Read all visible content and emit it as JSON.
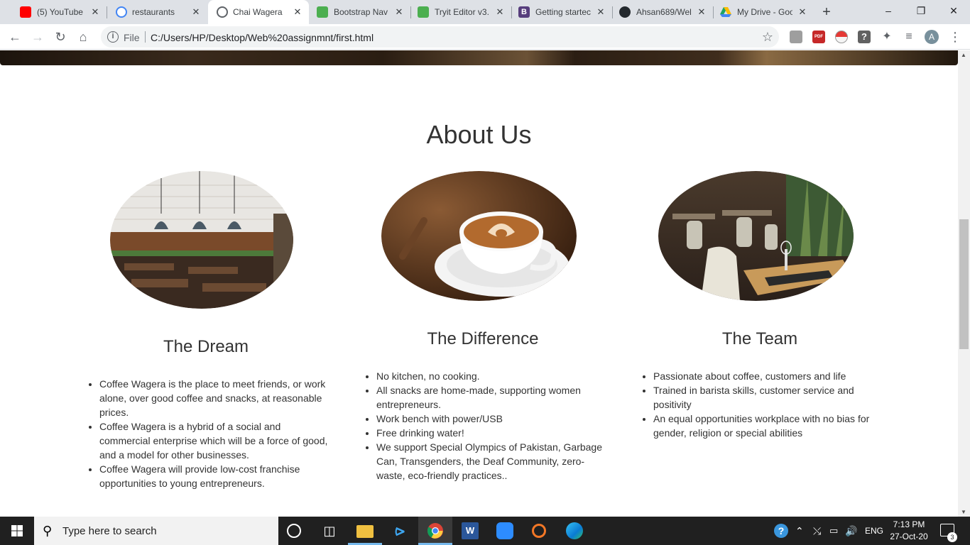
{
  "browser": {
    "tabs": [
      {
        "title": "(5) YouTube",
        "icon": "youtube-icon",
        "color": "#ff0000"
      },
      {
        "title": "restaurants ba",
        "icon": "google-icon",
        "color": "#4285f4"
      },
      {
        "title": "Chai Wagera",
        "icon": "globe-icon",
        "color": "#5f6368",
        "active": true
      },
      {
        "title": "Bootstrap Nav",
        "icon": "w3schools-icon",
        "color": "#4caf50"
      },
      {
        "title": "Tryit Editor v3.",
        "icon": "w3schools-icon",
        "color": "#4caf50"
      },
      {
        "title": "Getting startec",
        "icon": "bootstrap-icon",
        "color": "#563d7c"
      },
      {
        "title": "Ahsan689/Wel",
        "icon": "github-icon",
        "color": "#24292e"
      },
      {
        "title": "My Drive - Goo",
        "icon": "google-drive-icon",
        "color": "#fbbc04"
      }
    ],
    "new_tab": "+",
    "address": {
      "scheme_label": "File",
      "url": "C:/Users/HP/Desktop/Web%20assignmnt/first.html"
    },
    "profile_initial": "A"
  },
  "page": {
    "about_title": "About Us",
    "columns": [
      {
        "heading": "The Dream",
        "image": "restaurant-interior-photo",
        "items": [
          "Coffee Wagera is the place to meet friends, or work alone, over good coffee and snacks, at reasonable prices.",
          "Coffee Wagera is a hybrid of a social and commercial enterprise which will be a force of good, and a model for other businesses.",
          "Coffee Wagera will provide low-cost franchise opportunities to young entrepreneurs."
        ]
      },
      {
        "heading": "The Difference",
        "image": "latte-art-cup-photo",
        "items": [
          "No kitchen, no cooking.",
          "All snacks are home-made, supporting women entrepreneurs.",
          "Work bench with power/USB",
          "Free drinking water!",
          "We support Special Olympics of Pakistan, Garbage Can, Transgenders, the Deaf Community, zero-waste, eco-friendly practices.."
        ]
      },
      {
        "heading": "The Team",
        "image": "cafe-tables-photo",
        "items": [
          "Passionate about coffee, customers and life",
          "Trained in barista skills, customer service and positivity",
          "An equal opportunities workplace with no bias for gender, religion or special abilities"
        ]
      }
    ]
  },
  "taskbar": {
    "search_placeholder": "Type here to search",
    "language": "ENG",
    "time": "7:13 PM",
    "date": "27-Oct-20",
    "notification_count": "3"
  }
}
